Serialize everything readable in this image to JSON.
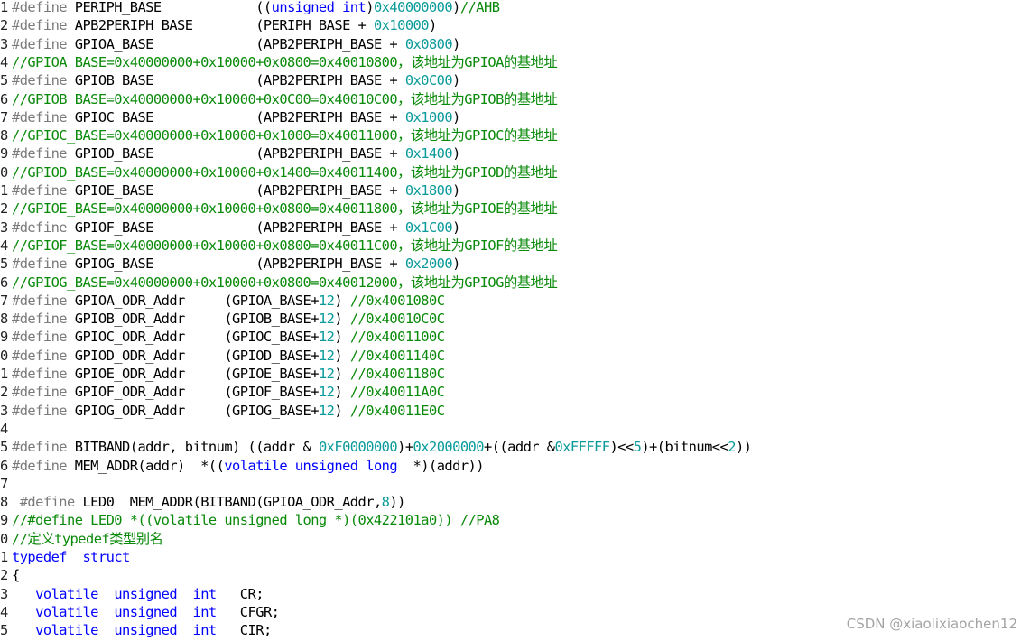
{
  "colors": {
    "preprocessor": "#7a7a7a",
    "comment": "#0a8a0a",
    "keyword": "#0000ff",
    "number": "#0a9a9a",
    "text": "#000000",
    "watermark": "#a3a3a3"
  },
  "watermark": "CSDN @xiaolixiaochen12",
  "lines": [
    {
      "ln": "1",
      "parts": [
        [
          "p",
          "#define"
        ],
        [
          "t",
          " PERIPH_BASE            (("
        ],
        [
          "k",
          "unsigned int"
        ],
        [
          "t",
          ")"
        ],
        [
          "n",
          "0x40000000"
        ],
        [
          "t",
          ")"
        ],
        [
          "c",
          "//AHB"
        ]
      ]
    },
    {
      "ln": "2",
      "parts": [
        [
          "p",
          "#define"
        ],
        [
          "t",
          " APB2PERIPH_BASE        (PERIPH_BASE + "
        ],
        [
          "n",
          "0x10000"
        ],
        [
          "t",
          ")"
        ]
      ]
    },
    {
      "ln": "3",
      "parts": [
        [
          "p",
          "#define"
        ],
        [
          "t",
          " GPIOA_BASE             (APB2PERIPH_BASE + "
        ],
        [
          "n",
          "0x0800"
        ],
        [
          "t",
          ")"
        ]
      ]
    },
    {
      "ln": "4",
      "parts": [
        [
          "c",
          "//GPIOA_BASE=0x40000000+0x10000+0x0800=0x40010800，该地址为GPIOA的基地址"
        ]
      ]
    },
    {
      "ln": "5",
      "parts": [
        [
          "p",
          "#define"
        ],
        [
          "t",
          " GPIOB_BASE             (APB2PERIPH_BASE + "
        ],
        [
          "n",
          "0x0C00"
        ],
        [
          "t",
          ")"
        ]
      ]
    },
    {
      "ln": "6",
      "parts": [
        [
          "c",
          "//GPIOB_BASE=0x40000000+0x10000+0x0C00=0x40010C00，该地址为GPIOB的基地址"
        ]
      ]
    },
    {
      "ln": "7",
      "parts": [
        [
          "p",
          "#define"
        ],
        [
          "t",
          " GPIOC_BASE             (APB2PERIPH_BASE + "
        ],
        [
          "n",
          "0x1000"
        ],
        [
          "t",
          ")"
        ]
      ]
    },
    {
      "ln": "8",
      "parts": [
        [
          "c",
          "//GPIOC_BASE=0x40000000+0x10000+0x1000=0x40011000，该地址为GPIOC的基地址"
        ]
      ]
    },
    {
      "ln": "9",
      "parts": [
        [
          "p",
          "#define"
        ],
        [
          "t",
          " GPIOD_BASE             (APB2PERIPH_BASE + "
        ],
        [
          "n",
          "0x1400"
        ],
        [
          "t",
          ")"
        ]
      ]
    },
    {
      "ln": "0",
      "parts": [
        [
          "c",
          "//GPIOD_BASE=0x40000000+0x10000+0x1400=0x40011400，该地址为GPIOD的基地址"
        ]
      ]
    },
    {
      "ln": "1",
      "parts": [
        [
          "p",
          "#define"
        ],
        [
          "t",
          " GPIOE_BASE             (APB2PERIPH_BASE + "
        ],
        [
          "n",
          "0x1800"
        ],
        [
          "t",
          ")"
        ]
      ]
    },
    {
      "ln": "2",
      "parts": [
        [
          "c",
          "//GPIOE_BASE=0x40000000+0x10000+0x0800=0x40011800，该地址为GPIOE的基地址"
        ]
      ]
    },
    {
      "ln": "3",
      "parts": [
        [
          "p",
          "#define"
        ],
        [
          "t",
          " GPIOF_BASE             (APB2PERIPH_BASE + "
        ],
        [
          "n",
          "0x1C00"
        ],
        [
          "t",
          ")"
        ]
      ]
    },
    {
      "ln": "4",
      "parts": [
        [
          "c",
          "//GPIOF_BASE=0x40000000+0x10000+0x0800=0x40011C00，该地址为GPIOF的基地址"
        ]
      ]
    },
    {
      "ln": "5",
      "parts": [
        [
          "p",
          "#define"
        ],
        [
          "t",
          " GPIOG_BASE             (APB2PERIPH_BASE + "
        ],
        [
          "n",
          "0x2000"
        ],
        [
          "t",
          ")"
        ]
      ]
    },
    {
      "ln": "6",
      "parts": [
        [
          "c",
          "//GPIOG_BASE=0x40000000+0x10000+0x0800=0x40012000，该地址为GPIOG的基地址"
        ]
      ]
    },
    {
      "ln": "7",
      "parts": [
        [
          "p",
          "#define"
        ],
        [
          "t",
          " GPIOA_ODR_Addr     (GPIOA_BASE+"
        ],
        [
          "n",
          "12"
        ],
        [
          "t",
          ") "
        ],
        [
          "c",
          "//0x4001080C"
        ]
      ]
    },
    {
      "ln": "8",
      "parts": [
        [
          "p",
          "#define"
        ],
        [
          "t",
          " GPIOB_ODR_Addr     (GPIOB_BASE+"
        ],
        [
          "n",
          "12"
        ],
        [
          "t",
          ") "
        ],
        [
          "c",
          "//0x40010C0C"
        ]
      ]
    },
    {
      "ln": "9",
      "parts": [
        [
          "p",
          "#define"
        ],
        [
          "t",
          " GPIOC_ODR_Addr     (GPIOC_BASE+"
        ],
        [
          "n",
          "12"
        ],
        [
          "t",
          ") "
        ],
        [
          "c",
          "//0x4001100C"
        ]
      ]
    },
    {
      "ln": "0",
      "parts": [
        [
          "p",
          "#define"
        ],
        [
          "t",
          " GPIOD_ODR_Addr     (GPIOD_BASE+"
        ],
        [
          "n",
          "12"
        ],
        [
          "t",
          ") "
        ],
        [
          "c",
          "//0x4001140C"
        ]
      ]
    },
    {
      "ln": "1",
      "parts": [
        [
          "p",
          "#define"
        ],
        [
          "t",
          " GPIOE_ODR_Addr     (GPIOE_BASE+"
        ],
        [
          "n",
          "12"
        ],
        [
          "t",
          ") "
        ],
        [
          "c",
          "//0x4001180C"
        ]
      ]
    },
    {
      "ln": "2",
      "parts": [
        [
          "p",
          "#define"
        ],
        [
          "t",
          " GPIOF_ODR_Addr     (GPIOF_BASE+"
        ],
        [
          "n",
          "12"
        ],
        [
          "t",
          ") "
        ],
        [
          "c",
          "//0x40011A0C"
        ]
      ]
    },
    {
      "ln": "3",
      "parts": [
        [
          "p",
          "#define"
        ],
        [
          "t",
          " GPIOG_ODR_Addr     (GPIOG_BASE+"
        ],
        [
          "n",
          "12"
        ],
        [
          "t",
          ") "
        ],
        [
          "c",
          "//0x40011E0C"
        ]
      ]
    },
    {
      "ln": "4",
      "parts": []
    },
    {
      "ln": "5",
      "parts": [
        [
          "p",
          "#define"
        ],
        [
          "t",
          " BITBAND(addr, bitnum) ((addr & "
        ],
        [
          "n",
          "0xF0000000"
        ],
        [
          "t",
          ")+"
        ],
        [
          "n",
          "0x2000000"
        ],
        [
          "t",
          "+((addr &"
        ],
        [
          "n",
          "0xFFFFF"
        ],
        [
          "t",
          ")<<"
        ],
        [
          "n",
          "5"
        ],
        [
          "t",
          ")+(bitnum<<"
        ],
        [
          "n",
          "2"
        ],
        [
          "t",
          "))"
        ]
      ]
    },
    {
      "ln": "6",
      "parts": [
        [
          "p",
          "#define"
        ],
        [
          "t",
          " MEM_ADDR(addr)  *(("
        ],
        [
          "k",
          "volatile unsigned long"
        ],
        [
          "t",
          "  *)(addr))"
        ]
      ]
    },
    {
      "ln": "7",
      "parts": []
    },
    {
      "ln": "8",
      "parts": [
        [
          "t",
          " "
        ],
        [
          "p",
          "#define"
        ],
        [
          "t",
          " LED0  MEM_ADDR(BITBAND(GPIOA_ODR_Addr,"
        ],
        [
          "n",
          "8"
        ],
        [
          "t",
          "))"
        ]
      ]
    },
    {
      "ln": "9",
      "parts": [
        [
          "c",
          "//#define LED0 *((volatile unsigned long *)(0x422101a0)) //PA8"
        ]
      ]
    },
    {
      "ln": "0",
      "parts": [
        [
          "c",
          "//定义typedef类型别名"
        ]
      ]
    },
    {
      "ln": "1",
      "parts": [
        [
          "k",
          "typedef"
        ],
        [
          "t",
          "  "
        ],
        [
          "k",
          "struct"
        ]
      ]
    },
    {
      "ln": "2",
      "parts": [
        [
          "t",
          "{"
        ]
      ]
    },
    {
      "ln": "3",
      "parts": [
        [
          "t",
          "   "
        ],
        [
          "k",
          "volatile"
        ],
        [
          "t",
          "  "
        ],
        [
          "k",
          "unsigned"
        ],
        [
          "t",
          "  "
        ],
        [
          "k",
          "int"
        ],
        [
          "t",
          "   CR;"
        ]
      ]
    },
    {
      "ln": "4",
      "parts": [
        [
          "t",
          "   "
        ],
        [
          "k",
          "volatile"
        ],
        [
          "t",
          "  "
        ],
        [
          "k",
          "unsigned"
        ],
        [
          "t",
          "  "
        ],
        [
          "k",
          "int"
        ],
        [
          "t",
          "   CFGR;"
        ]
      ]
    },
    {
      "ln": "5",
      "parts": [
        [
          "t",
          "   "
        ],
        [
          "k",
          "volatile"
        ],
        [
          "t",
          "  "
        ],
        [
          "k",
          "unsigned"
        ],
        [
          "t",
          "  "
        ],
        [
          "k",
          "int"
        ],
        [
          "t",
          "   CIR;"
        ]
      ]
    }
  ]
}
